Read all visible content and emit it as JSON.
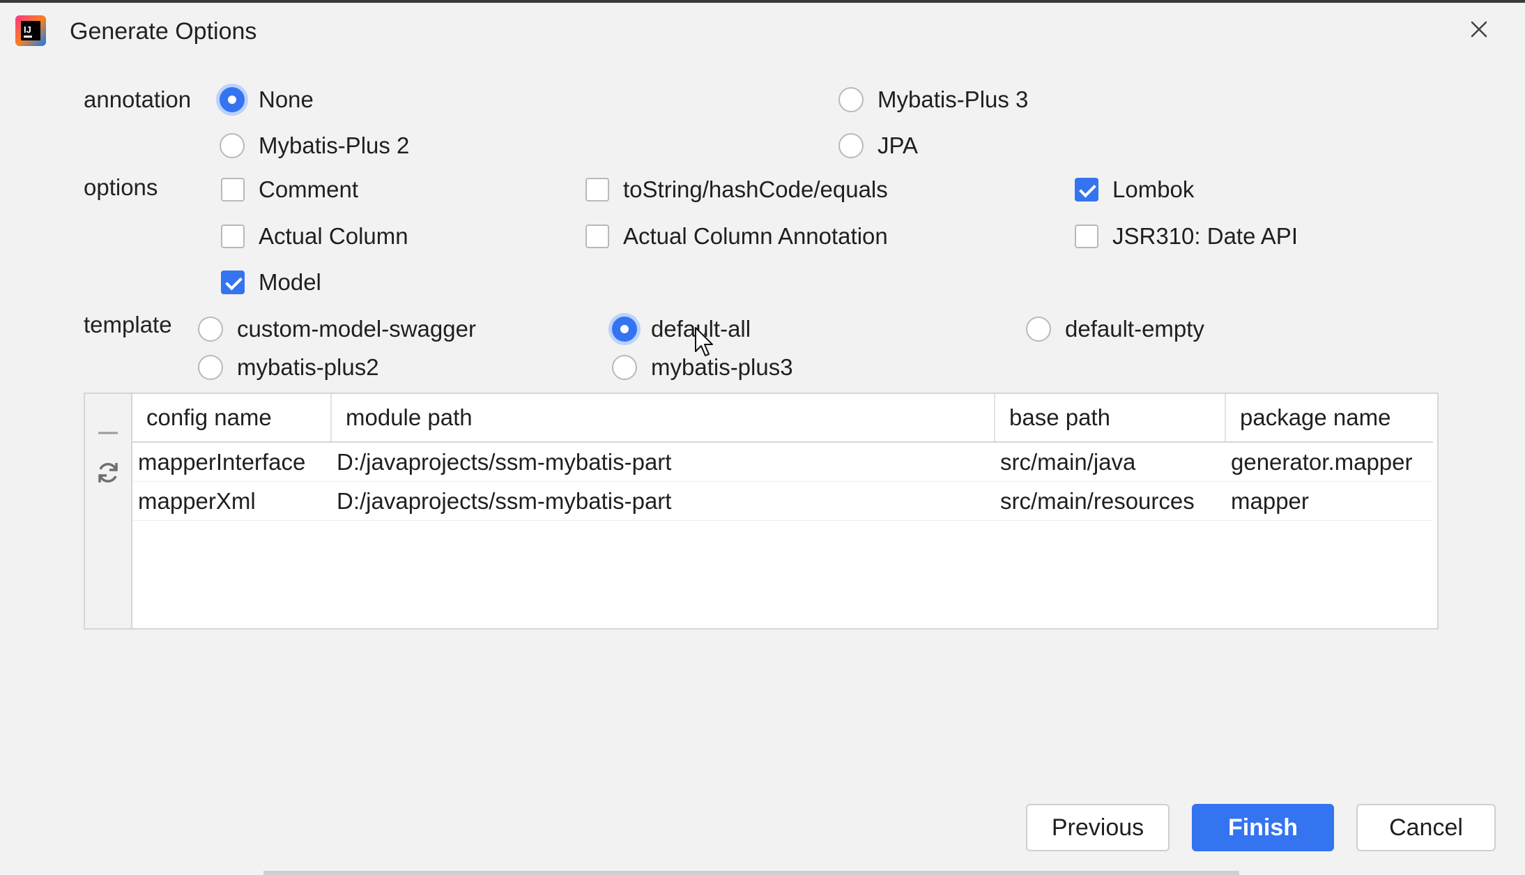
{
  "window": {
    "title": "Generate Options",
    "icon": "intellij-app-icon",
    "close_icon": "close-icon"
  },
  "annotation": {
    "label": "annotation",
    "options": [
      {
        "label": "None",
        "selected": true
      },
      {
        "label": "Mybatis-Plus 3",
        "selected": false
      },
      {
        "label": "Mybatis-Plus 2",
        "selected": false
      },
      {
        "label": "JPA",
        "selected": false
      }
    ]
  },
  "options": {
    "label": "options",
    "items": [
      {
        "label": "Comment",
        "checked": false
      },
      {
        "label": "toString/hashCode/equals",
        "checked": false
      },
      {
        "label": "Lombok",
        "checked": true
      },
      {
        "label": "Actual Column",
        "checked": false
      },
      {
        "label": "Actual Column Annotation",
        "checked": false
      },
      {
        "label": "JSR310: Date API",
        "checked": false
      },
      {
        "label": "Model",
        "checked": true
      }
    ]
  },
  "template": {
    "label": "template",
    "options": [
      {
        "label": "custom-model-swagger",
        "selected": false
      },
      {
        "label": "default-all",
        "selected": true
      },
      {
        "label": "default-empty",
        "selected": false
      },
      {
        "label": "mybatis-plus2",
        "selected": false
      },
      {
        "label": "mybatis-plus3",
        "selected": false
      }
    ]
  },
  "table": {
    "columns": [
      "config name",
      "module path",
      "base path",
      "package name"
    ],
    "rows": [
      [
        "mapperInterface",
        "D:/javaprojects/ssm-mybatis-part",
        "src/main/java",
        "generator.mapper"
      ],
      [
        "mapperXml",
        "D:/javaprojects/ssm-mybatis-part",
        "src/main/resources",
        "mapper"
      ]
    ],
    "side_icons": [
      "minus-icon",
      "refresh-icon"
    ]
  },
  "buttons": {
    "previous": "Previous",
    "finish": "Finish",
    "cancel": "Cancel"
  },
  "colors": {
    "accent": "#3574f0",
    "background": "#f2f2f2"
  }
}
